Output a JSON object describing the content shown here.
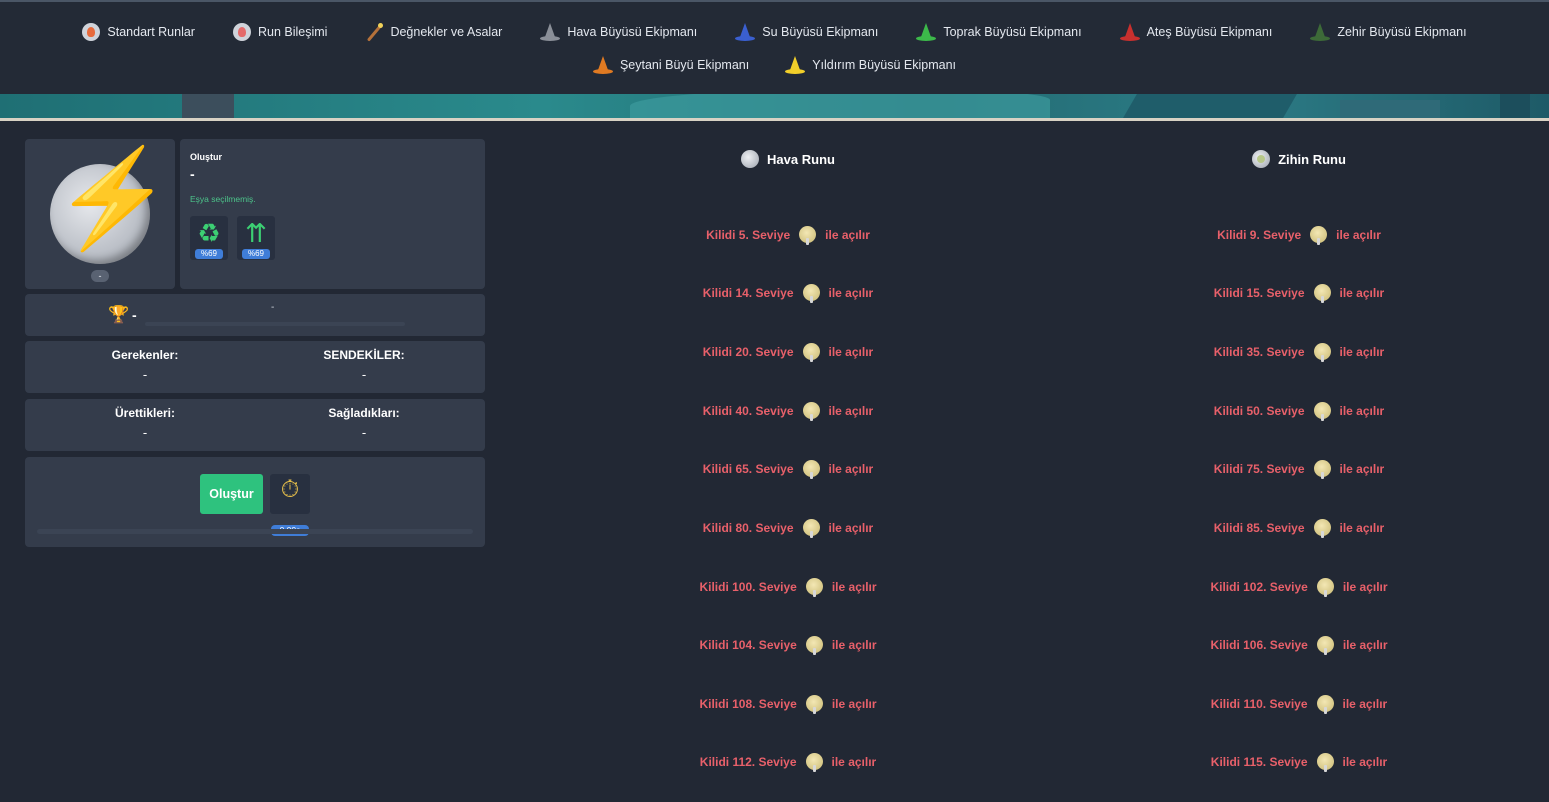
{
  "nav": {
    "row1": [
      {
        "label": "Standart Runlar",
        "icon": "fire-rune-icon",
        "kind": "circle"
      },
      {
        "label": "Run Bileşimi",
        "icon": "rune-combination-icon",
        "kind": "circle-pink"
      },
      {
        "label": "Değnekler ve Asalar",
        "icon": "wand-icon",
        "kind": "wand"
      },
      {
        "label": "Hava Büyüsü Ekipmanı",
        "icon": "gray-wizard-hat-icon",
        "kind": "hat",
        "color": "#8a8f98"
      },
      {
        "label": "Su Büyüsü Ekipmanı",
        "icon": "blue-wizard-hat-icon",
        "kind": "hat",
        "color": "#3a5fd0"
      },
      {
        "label": "Toprak Büyüsü Ekipmanı",
        "icon": "green-wizard-hat-icon",
        "kind": "hat",
        "color": "#3cb94a"
      },
      {
        "label": "Ateş Büyüsü Ekipmanı",
        "icon": "red-wizard-hat-icon",
        "kind": "hat",
        "color": "#c8302e"
      },
      {
        "label": "Zehir Büyüsü Ekipmanı",
        "icon": "dark-green-wizard-hat-icon",
        "kind": "hat",
        "color": "#3d6a38"
      }
    ],
    "row2": [
      {
        "label": "Şeytani Büyü Ekipmanı",
        "icon": "orange-wizard-hat-icon",
        "kind": "hat",
        "color": "#e07a22"
      },
      {
        "label": "Yıldırım Büyüsü Ekipmanı",
        "icon": "yellow-wizard-hat-icon",
        "kind": "hat",
        "color": "#f2cf2a"
      }
    ]
  },
  "item": {
    "orb_badge": "-",
    "title": "Oluştur",
    "name": "-",
    "note": "Eşya seçilmemiş.",
    "mini1_pct": "%69",
    "mini2_pct": "%69"
  },
  "rank": {
    "value": "-",
    "small": "-"
  },
  "requirements": {
    "left_label": "Gerekenler:",
    "left_value": "-",
    "right_label": "SENDEKİLER:",
    "right_value": "-"
  },
  "production": {
    "left_label": "Ürettikleri:",
    "left_value": "-",
    "right_label": "Sağladıkları:",
    "right_value": "-"
  },
  "craft": {
    "button_label": "Oluştur",
    "timer": "0,00s"
  },
  "runes": {
    "air": {
      "title": "Hava Runu",
      "locks": [
        {
          "prefix": "Kilidi 5. Seviye",
          "suffix": "ile açılır"
        },
        {
          "prefix": "Kilidi 14. Seviye",
          "suffix": "ile açılır"
        },
        {
          "prefix": "Kilidi 20. Seviye",
          "suffix": "ile açılır"
        },
        {
          "prefix": "Kilidi 40. Seviye",
          "suffix": "ile açılır"
        },
        {
          "prefix": "Kilidi 65. Seviye",
          "suffix": "ile açılır"
        },
        {
          "prefix": "Kilidi 80. Seviye",
          "suffix": "ile açılır"
        },
        {
          "prefix": "Kilidi 100. Seviye",
          "suffix": "ile açılır"
        },
        {
          "prefix": "Kilidi 104. Seviye",
          "suffix": "ile açılır"
        },
        {
          "prefix": "Kilidi 108. Seviye",
          "suffix": "ile açılır"
        },
        {
          "prefix": "Kilidi 112. Seviye",
          "suffix": "ile açılır"
        }
      ]
    },
    "mind": {
      "title": "Zihin Runu",
      "locks": [
        {
          "prefix": "Kilidi 9. Seviye",
          "suffix": "ile açılır"
        },
        {
          "prefix": "Kilidi 15. Seviye",
          "suffix": "ile açılır"
        },
        {
          "prefix": "Kilidi 35. Seviye",
          "suffix": "ile açılır"
        },
        {
          "prefix": "Kilidi 50. Seviye",
          "suffix": "ile açılır"
        },
        {
          "prefix": "Kilidi 75. Seviye",
          "suffix": "ile açılır"
        },
        {
          "prefix": "Kilidi 85. Seviye",
          "suffix": "ile açılır"
        },
        {
          "prefix": "Kilidi 102. Seviye",
          "suffix": "ile açılır"
        },
        {
          "prefix": "Kilidi 106. Seviye",
          "suffix": "ile açılır"
        },
        {
          "prefix": "Kilidi 110. Seviye",
          "suffix": "ile açılır"
        },
        {
          "prefix": "Kilidi 115. Seviye",
          "suffix": "ile açılır"
        }
      ]
    }
  }
}
